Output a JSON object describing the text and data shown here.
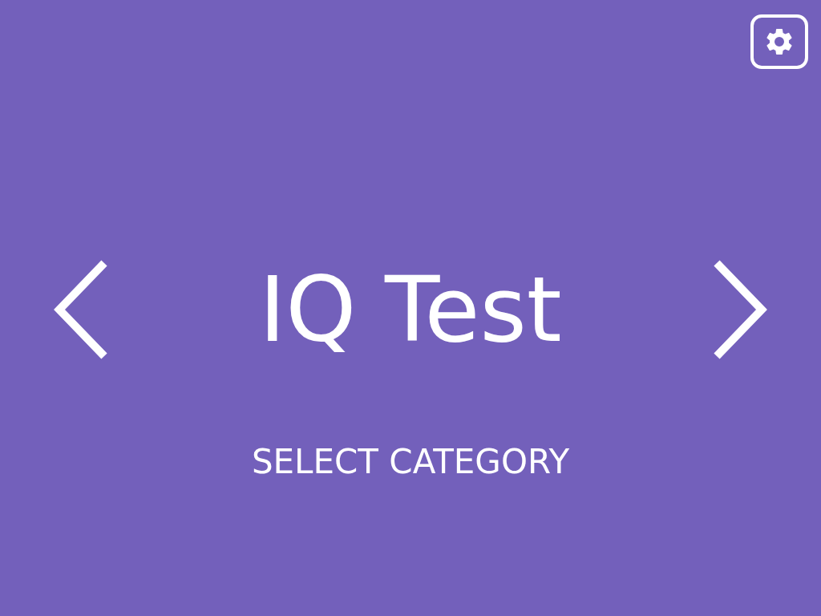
{
  "title": "IQ Test",
  "action": "SELECT CATEGORY"
}
